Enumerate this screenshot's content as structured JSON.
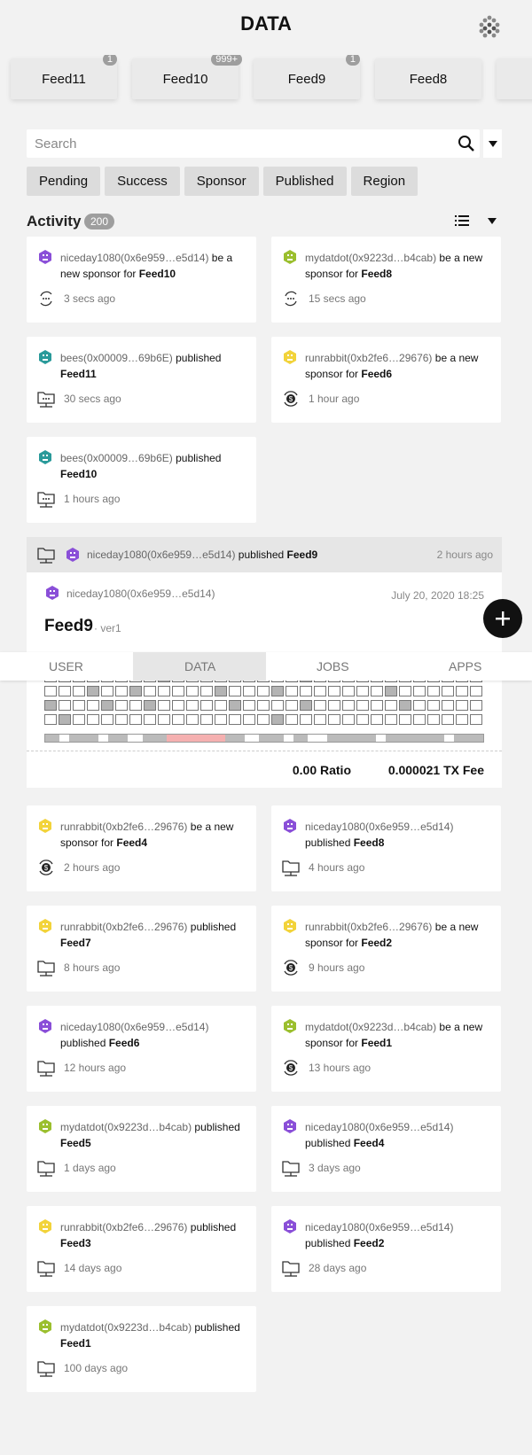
{
  "header": {
    "title": "DATA"
  },
  "feeds": [
    {
      "label": "Feed11",
      "badge": "1"
    },
    {
      "label": "Feed10",
      "badge": "999+"
    },
    {
      "label": "Feed9",
      "badge": "1"
    },
    {
      "label": "Feed8",
      "badge": ""
    }
  ],
  "search": {
    "placeholder": "Search"
  },
  "filters": [
    "Pending",
    "Success",
    "Sponsor",
    "Published",
    "Region"
  ],
  "activity": {
    "title": "Activity",
    "count": "200"
  },
  "colors": {
    "purple": "#8a4fd8",
    "olive": "#9bbf2e",
    "teal": "#2a9a9a",
    "yellow": "#f2d33a"
  },
  "cards_top": [
    {
      "user": "niceday1080(0x6e959…e5d14)",
      "action": " be a new sponsor for ",
      "feed": "Feed10",
      "time": "3 secs ago",
      "avatar": "purple",
      "icon": "pending-icon"
    },
    {
      "user": "mydatdot(0x9223d…b4cab)",
      "action": " be a new sponsor for ",
      "feed": "Feed8",
      "time": "15 secs ago",
      "avatar": "olive",
      "icon": "pending-icon"
    },
    {
      "user": "bees(0x00009…69b6E)",
      "action": " published ",
      "feed": "Feed11",
      "time": "30 secs ago",
      "avatar": "teal",
      "icon": "folder-pending-icon"
    },
    {
      "user": "runrabbit(0xb2fe6…29676)",
      "action": " be a new sponsor for ",
      "feed": "Feed6",
      "time": "1 hour ago",
      "avatar": "yellow",
      "icon": "sponsor-icon"
    },
    {
      "user": "bees(0x00009…69b6E)",
      "action": " published ",
      "feed": "Feed10",
      "time": "1 hours ago",
      "avatar": "teal",
      "icon": "folder-pending-icon"
    }
  ],
  "expanded": {
    "user": "niceday1080(0x6e959…e5d14)",
    "action": " published ",
    "feed": "Feed9",
    "time": "2 hours ago",
    "detail_user": "niceday1080(0x6e959…e5d14)",
    "date": "July 20, 2020 18:25",
    "title": "Feed9",
    "version": "· ver1",
    "ratio": "0.00 Ratio",
    "tx_fee": "0.000021 TX Fee"
  },
  "tabs": [
    "USER",
    "DATA",
    "JOBS",
    "APPS"
  ],
  "cards_bottom": [
    {
      "user": "runrabbit(0xb2fe6…29676)",
      "action": " be a new sponsor for ",
      "feed": "Feed4",
      "time": "2 hours ago",
      "avatar": "yellow",
      "icon": "sponsor-icon"
    },
    {
      "user": "niceday1080(0x6e959…e5d14)",
      "action": " published ",
      "feed": "Feed8",
      "time": "4 hours ago",
      "avatar": "purple",
      "icon": "folder-icon"
    },
    {
      "user": "runrabbit(0xb2fe6…29676)",
      "action": " published ",
      "feed": "Feed7",
      "time": "8 hours ago",
      "avatar": "yellow",
      "icon": "folder-icon"
    },
    {
      "user": "runrabbit(0xb2fe6…29676)",
      "action": " be a new sponsor for ",
      "feed": "Feed2",
      "time": "9 hours ago",
      "avatar": "yellow",
      "icon": "sponsor-icon"
    },
    {
      "user": "niceday1080(0x6e959…e5d14)",
      "action": " published ",
      "feed": "Feed6",
      "time": "12 hours ago",
      "avatar": "purple",
      "icon": "folder-icon"
    },
    {
      "user": "mydatdot(0x9223d…b4cab)",
      "action": " be a new sponsor for ",
      "feed": "Feed1",
      "time": "13 hours ago",
      "avatar": "olive",
      "icon": "sponsor-icon"
    },
    {
      "user": "mydatdot(0x9223d…b4cab)",
      "action": " published ",
      "feed": "Feed5",
      "time": "1 days ago",
      "avatar": "olive",
      "icon": "folder-icon"
    },
    {
      "user": "niceday1080(0x6e959…e5d14)",
      "action": " published ",
      "feed": "Feed4",
      "time": "3 days ago",
      "avatar": "purple",
      "icon": "folder-icon"
    },
    {
      "user": "runrabbit(0xb2fe6…29676)",
      "action": " published ",
      "feed": "Feed3",
      "time": "14 days ago",
      "avatar": "yellow",
      "icon": "folder-icon"
    },
    {
      "user": "niceday1080(0x6e959…e5d14)",
      "action": " published ",
      "feed": "Feed2",
      "time": "28 days ago",
      "avatar": "purple",
      "icon": "folder-icon"
    },
    {
      "user": "mydatdot(0x9223d…b4cab)",
      "action": " published ",
      "feed": "Feed1",
      "time": "100 days ago",
      "avatar": "olive",
      "icon": "folder-icon"
    }
  ]
}
